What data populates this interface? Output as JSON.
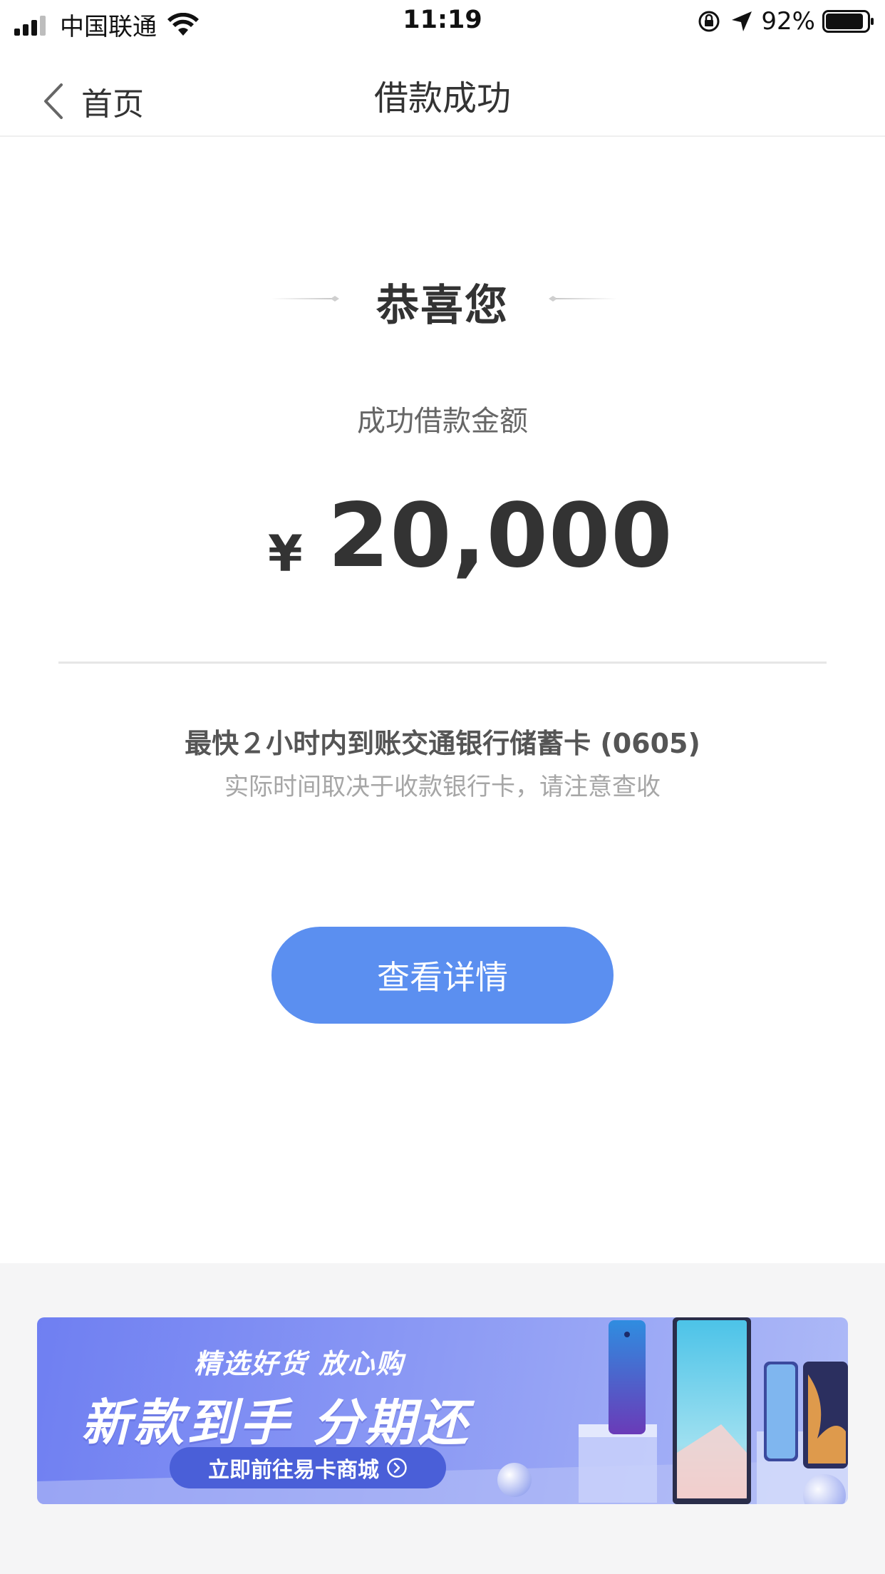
{
  "status_bar": {
    "carrier": "中国联通",
    "time": "11:19",
    "battery_percent": "92%",
    "signal_bars": 4,
    "signal_active": 3,
    "battery_level": 0.92
  },
  "nav": {
    "back_label": "首页",
    "title": "借款成功"
  },
  "result": {
    "congrats": "恭喜您",
    "amount_label": "成功借款金额",
    "currency_symbol": "¥",
    "amount": "20,000",
    "arrival_main": "最快２小时内到账交通银行储蓄卡 (0605)",
    "arrival_sub": "实际时间取决于收款银行卡，请注意查收",
    "detail_button": "查看详情"
  },
  "banner": {
    "tagline": "精选好货 放心购",
    "headline": "新款到手 分期还",
    "cta": "立即前往易卡商城"
  },
  "colors": {
    "primary_button": "#5b8ff0",
    "banner_start": "#6f7ff2",
    "banner_end": "#aebaf7",
    "page_bg_bottom": "#f5f5f6"
  },
  "icons": [
    "signal-icon",
    "wifi-icon",
    "rotation-lock-icon",
    "location-arrow-icon",
    "battery-icon",
    "back-chevron-icon",
    "chevron-right-circle-icon"
  ]
}
